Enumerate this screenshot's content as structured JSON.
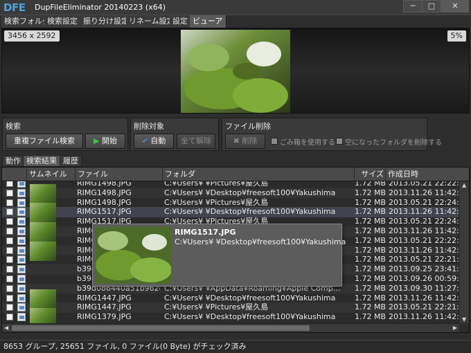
{
  "window": {
    "logo": "DFE",
    "title": "DupFileEliminator 20140223 (x64)",
    "minimize": "─",
    "maximize": "□",
    "close": "✕"
  },
  "tabs": [
    "検索フォルダ",
    "検索設定",
    "振り分け設定",
    "リネーム設定",
    "設定",
    "ビューア"
  ],
  "viewer": {
    "dimensions": "3456 x 2592",
    "zoom": "5%"
  },
  "search_group": {
    "title": "検索",
    "dup_search": "重複ファイル検索",
    "start": "開始"
  },
  "target_group": {
    "title": "削除対象",
    "auto": "自動",
    "clear_all": "全て解除"
  },
  "delete_group": {
    "title": "ファイル削除",
    "delete": "削除",
    "use_recycle": "ごみ箱を使用する",
    "remove_empty": "空になったフォルダを削除する"
  },
  "lower_tabs": [
    "動作",
    "検索結果",
    "履歴"
  ],
  "columns": {
    "thumbnail": "サムネイル",
    "file": "ファイル",
    "folder": "フォルダ",
    "size": "サイズ",
    "created": "作成日時"
  },
  "rows": [
    {
      "file": "RIMG1498.JPG",
      "folder": "C:¥Users¥     ¥Pictures¥屋久島",
      "size": "1.72 MB",
      "created": "2013.05.21 22:22:1"
    },
    {
      "file": "RIMG1498.JPG",
      "folder": "C:¥Users¥     ¥Desktop¥freesoft100¥Yakushima",
      "size": "1.72 MB",
      "created": "2013.11.26 11:42:4"
    },
    {
      "file": "RIMG1498.JPG",
      "folder": "C:¥Users¥     ¥Pictures¥屋久島",
      "size": "1.72 MB",
      "created": "2013.05.21 22:24:0"
    },
    {
      "file": "RIMG1517.JPG",
      "folder": "C:¥Users¥     ¥Desktop¥freesoft100¥Yakushima",
      "size": "1.72 MB",
      "created": "2013.11.26 11:42:4"
    },
    {
      "file": "RIMG1517.JPG",
      "folder": "C:¥Users¥     ¥Pictures¥屋久島",
      "size": "1.72 MB",
      "created": "2013.05.21 22:24:5"
    },
    {
      "file": "RIMG1",
      "folder": "",
      "size": "1.72 MB",
      "created": "2013.11.26 11:42:3"
    },
    {
      "file": "RIMG",
      "folder": "",
      "size": "1.72 MB",
      "created": "2013.05.21 22:22:0"
    },
    {
      "file": "RIMG",
      "folder": "",
      "size": "1.72 MB",
      "created": "2013.11.26 11:42:3"
    },
    {
      "file": "RIMG",
      "folder": "",
      "size": "1.72 MB",
      "created": "2013.05.21 22:21:5"
    },
    {
      "file": "b39d",
      "folder": "",
      "size": "1.72 MB",
      "created": "2013.09.25 23:41:2"
    },
    {
      "file": "b39d",
      "folder": "",
      "size": "1.72 MB",
      "created": "2013.09.26 00:59:4"
    },
    {
      "file": "b39d086440a51b962d…",
      "folder": "C:¥Users¥     ¥AppData¥Roaming¥Apple Comp…",
      "size": "1.72 MB",
      "created": "2013.09.30 11:27:2"
    },
    {
      "file": "RIMG1447.JPG",
      "folder": "C:¥Users¥     ¥Desktop¥freesoft100¥Yakushima",
      "size": "1.72 MB",
      "created": "2013.11.26 11:42:4"
    },
    {
      "file": "RIMG1447.JPG",
      "folder": "C:¥Users¥     ¥Pictures¥屋久島",
      "size": "1.72 MB",
      "created": "2013.05.21 22:21:4"
    },
    {
      "file": "RIMG1379.JPG",
      "folder": "C:¥Users¥     ¥Desktop¥freesoft100¥Yakushima",
      "size": "1.72 MB",
      "created": "2013.11.26 11:42:4"
    }
  ],
  "tooltip": {
    "name": "RIMG1517.JPG",
    "path": "C:¥Users¥     ¥Desktop¥freesoft100¥Yakushima"
  },
  "status": "8653 グループ, 25651 ファイル, 0 ファイル(0 Byte) がチェック済み",
  "colors": {
    "accent": "#4fa3e0",
    "start_icon": "#3cc23c",
    "auto_icon": "#3a8ee6",
    "background": "#2d2d2d"
  }
}
